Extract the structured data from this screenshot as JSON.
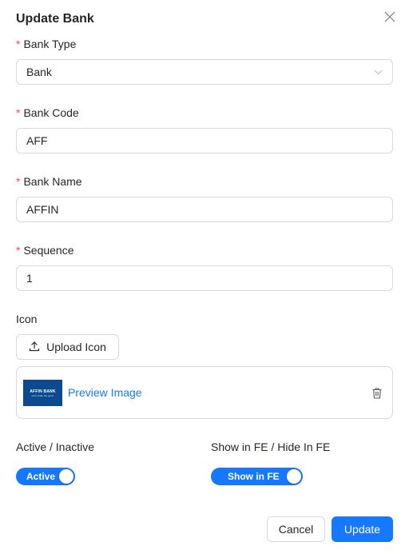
{
  "modal": {
    "title": "Update Bank"
  },
  "form": {
    "bank_type": {
      "label": "Bank Type",
      "required_mark": "*",
      "value": "Bank"
    },
    "bank_code": {
      "label": "Bank Code",
      "required_mark": "*",
      "value": "AFF"
    },
    "bank_name": {
      "label": "Bank Name",
      "required_mark": "*",
      "value": "AFFIN"
    },
    "sequence": {
      "label": "Sequence",
      "required_mark": "*",
      "value": "1"
    },
    "icon": {
      "label": "Icon",
      "upload_label": "Upload Icon",
      "preview_label": "Preview Image",
      "thumbnail": {
        "logo_text": "AFFIN BANK",
        "sub_text": "Let's make the good."
      }
    },
    "active": {
      "label": "Active / Inactive",
      "switch_text": "Active",
      "checked": true
    },
    "show_fe": {
      "label": "Show in FE / Hide In FE",
      "switch_text": "Show in FE",
      "checked": true
    }
  },
  "footer": {
    "cancel_label": "Cancel",
    "update_label": "Update"
  },
  "colors": {
    "primary": "#1677ff",
    "required": "#ff4d4f",
    "border": "#d9d9d9",
    "thumb_bg": "#0b4a8f"
  },
  "icons": {
    "close": "close-icon",
    "chevron": "chevron-down-icon",
    "upload": "upload-icon",
    "delete": "trash-icon"
  }
}
